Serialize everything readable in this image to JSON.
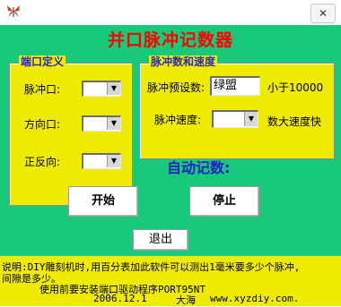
{
  "window": {
    "close_glyph": "✕",
    "icon": "butterfly-icon"
  },
  "app": {
    "title": "并口脉冲记数器"
  },
  "port_group": {
    "legend": "端口定义",
    "pulse_port_label": "脉冲口:",
    "pulse_port_value": "",
    "direction_port_label": "方向口:",
    "direction_port_value": "",
    "fwd_rev_label": "正反向:",
    "fwd_rev_value": ""
  },
  "speed_group": {
    "legend": "脉冲数和速度",
    "preset_label": "脉冲预设数:",
    "preset_value": "绿盟",
    "less_than_label": "小于10000",
    "speed_label": "脉冲速度:",
    "speed_value": "",
    "hint": "数大速度快"
  },
  "auto_count_label": "自动记数:",
  "buttons": {
    "start": "开始",
    "stop": "停止",
    "exit": "退出"
  },
  "footer": {
    "line1": "说明:DIY雕刻机时,用百分表加此软件可以测出1毫米要多少个脉冲,",
    "line2": "间隙是多少。",
    "line3": "使用前要安装端口驱动程序PORT95NT",
    "date": "2006.12.1",
    "author": "大海",
    "website": "www.xyzdiy.com."
  },
  "colors": {
    "client_bg": "#18c97a",
    "group_bg": "#eeea00",
    "title_red": "#ff0000",
    "accent_blue": "#2020c8"
  }
}
